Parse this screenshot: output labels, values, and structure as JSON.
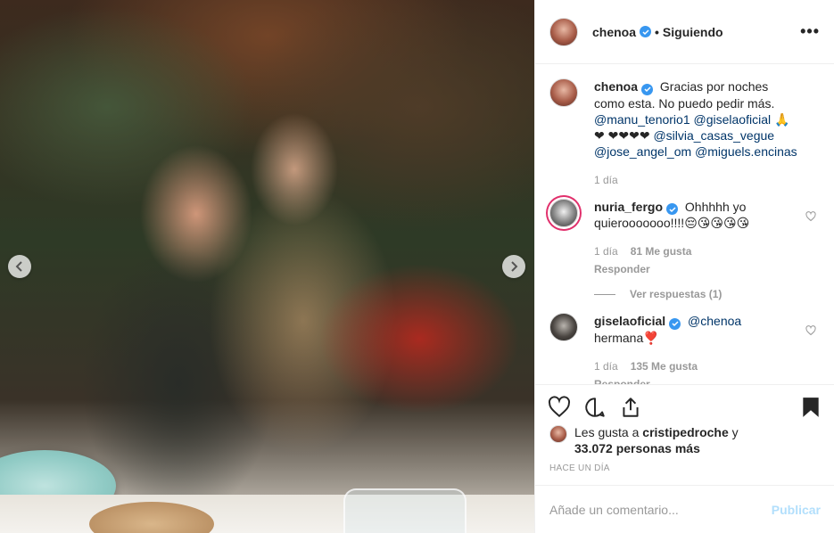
{
  "colors": {
    "accent": "#3897f0",
    "mention": "#003569",
    "muted": "#999999",
    "publish_disabled": "#b2dffc"
  },
  "header": {
    "username": "chenoa",
    "separator": "•",
    "follow_status": "Siguiendo",
    "more_icon": "more-horizontal-icon"
  },
  "caption": {
    "username": "chenoa",
    "text_a": "Gracias por noches como esta. No puedo pedir más.",
    "mention_1": "@manu_tenorio1",
    "mention_2": "@giselaoficial",
    "emoji_a": "🙏❤",
    "emoji_b": "❤❤❤❤",
    "mention_3": "@silvia_casas_vegue",
    "mention_4": "@jose_angel_om",
    "mention_5": "@miguels.encinas",
    "time": "1 día"
  },
  "comments": [
    {
      "username": "nuria_fergo",
      "text": "Ohhhhh yo quierooooooo!!!!😔😘😘😘😘",
      "time": "1 día",
      "likes": "81 Me gusta",
      "reply": "Responder",
      "view_replies": "Ver respuestas (1)"
    },
    {
      "username": "giselaoficial",
      "mention": "@chenoa",
      "text": "hermana❣️",
      "time": "1 día",
      "likes": "135 Me gusta",
      "reply": "Responder"
    }
  ],
  "likes": {
    "prefix": "Les gusta a",
    "user": "cristipedroche",
    "joiner": "y",
    "count": "33.072 personas más"
  },
  "timestamp": "HACE UN DÍA",
  "add_comment": {
    "placeholder": "Añade un comentario...",
    "publish": "Publicar"
  }
}
